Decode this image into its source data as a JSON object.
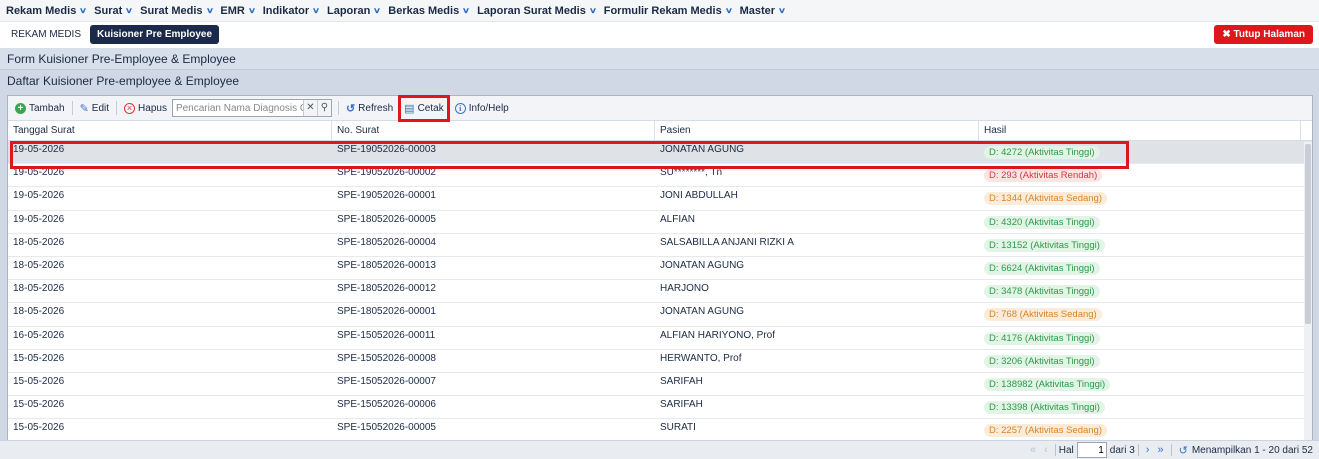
{
  "menu": [
    {
      "label": "Rekam Medis"
    },
    {
      "label": "Surat"
    },
    {
      "label": "Surat Medis"
    },
    {
      "label": "EMR"
    },
    {
      "label": "Indikator"
    },
    {
      "label": "Laporan"
    },
    {
      "label": "Berkas Medis"
    },
    {
      "label": "Laporan Surat Medis"
    },
    {
      "label": "Formulir Rekam Medis"
    },
    {
      "label": "Master"
    }
  ],
  "tabs": [
    {
      "label": "REKAM MEDIS"
    },
    {
      "label": "Kuisioner Pre Employee"
    }
  ],
  "close_button": "✖ Tutup Halaman",
  "form_title": "Form Kuisioner Pre-Employee & Employee",
  "list_title": "Daftar Kuisioner Pre-employee & Employee",
  "toolbar": {
    "add": "Tambah",
    "edit": "Edit",
    "delete": "Hapus",
    "search_placeholder": "Pencarian Nama Diagnosis Gizi",
    "refresh": "Refresh",
    "print": "Cetak",
    "info": "Info/Help"
  },
  "columns": [
    "Tanggal Surat",
    "No. Surat",
    "Pasien",
    "Hasil"
  ],
  "rows": [
    {
      "date": "19-05-2026",
      "no": "SPE-19052026-00003",
      "patient": "JONATAN AGUNG",
      "result": "D: 4272 (Aktivitas Tinggi)",
      "status": "green"
    },
    {
      "date": "19-05-2026",
      "no": "SPE-19052026-00002",
      "patient": "SU********, Tn",
      "result": "D: 293 (Aktivitas Rendah)",
      "status": "red"
    },
    {
      "date": "19-05-2026",
      "no": "SPE-19052026-00001",
      "patient": "JONI ABDULLAH",
      "result": "D: 1344 (Aktivitas Sedang)",
      "status": "orange"
    },
    {
      "date": "19-05-2026",
      "no": "SPE-18052026-00005",
      "patient": "ALFIAN",
      "result": "D: 4320 (Aktivitas Tinggi)",
      "status": "green"
    },
    {
      "date": "18-05-2026",
      "no": "SPE-18052026-00004",
      "patient": "SALSABILLA ANJANI RIZKI A",
      "result": "D: 13152 (Aktivitas Tinggi)",
      "status": "green"
    },
    {
      "date": "18-05-2026",
      "no": "SPE-18052026-00013",
      "patient": "JONATAN AGUNG",
      "result": "D: 6624 (Aktivitas Tinggi)",
      "status": "green"
    },
    {
      "date": "18-05-2026",
      "no": "SPE-18052026-00012",
      "patient": "HARJONO",
      "result": "D: 3478 (Aktivitas Tinggi)",
      "status": "green"
    },
    {
      "date": "18-05-2026",
      "no": "SPE-18052026-00001",
      "patient": "JONATAN AGUNG",
      "result": "D: 768 (Aktivitas Sedang)",
      "status": "orange"
    },
    {
      "date": "16-05-2026",
      "no": "SPE-15052026-00011",
      "patient": "ALFIAN HARIYONO, Prof",
      "result": "D: 4176 (Aktivitas Tinggi)",
      "status": "green"
    },
    {
      "date": "15-05-2026",
      "no": "SPE-15052026-00008",
      "patient": "HERWANTO, Prof",
      "result": "D: 3206 (Aktivitas Tinggi)",
      "status": "green"
    },
    {
      "date": "15-05-2026",
      "no": "SPE-15052026-00007",
      "patient": "SARIFAH",
      "result": "D: 138982 (Aktivitas Tinggi)",
      "status": "green"
    },
    {
      "date": "15-05-2026",
      "no": "SPE-15052026-00006",
      "patient": "SARIFAH",
      "result": "D: 13398 (Aktivitas Tinggi)",
      "status": "green"
    },
    {
      "date": "15-05-2026",
      "no": "SPE-15052026-00005",
      "patient": "SURATI",
      "result": "D: 2257 (Aktivitas Sedang)",
      "status": "orange"
    }
  ],
  "pager": {
    "page_label": "Hal",
    "current_page": "1",
    "of_label": "dari 3",
    "summary": "Menampilkan 1 - 20 dari 52"
  }
}
